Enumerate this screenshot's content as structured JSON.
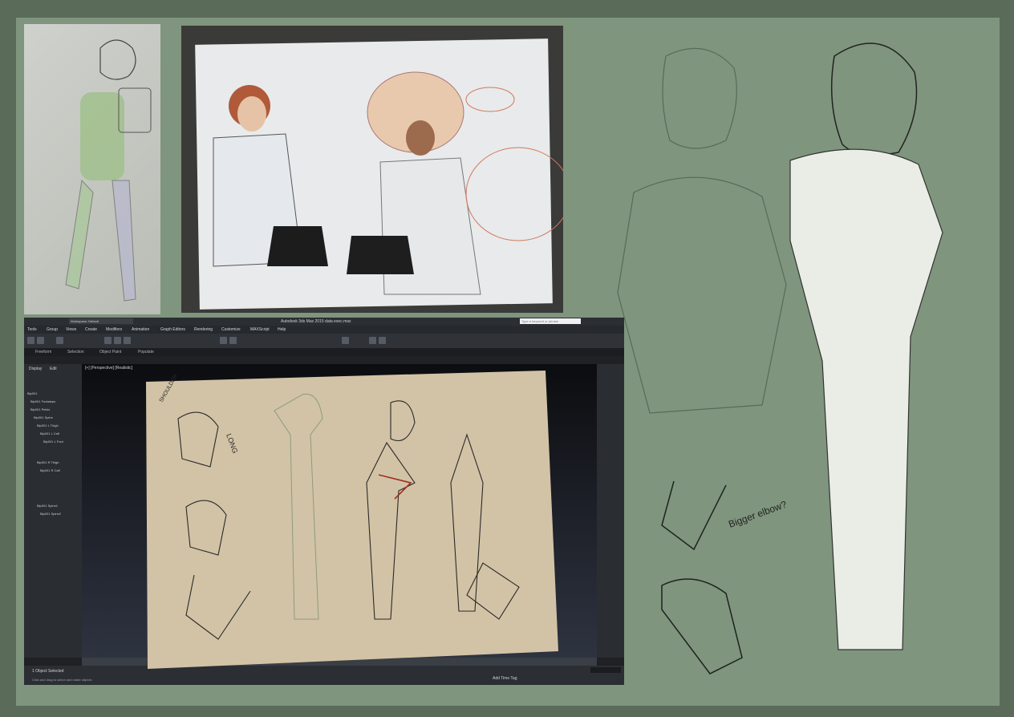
{
  "max": {
    "title": "Autodesk 3ds Max 2015    data exec.max",
    "workspace": "Workspace: Default",
    "search_placeholder": "Type a keyword or phrase",
    "menu": [
      "Tools",
      "Group",
      "Views",
      "Create",
      "Modifiers",
      "Animation",
      "Graph Editors",
      "Rendering",
      "Customize",
      "MAXScript",
      "Help"
    ],
    "ribbon": [
      "Freeform",
      "Selection",
      "Object Paint",
      "Populate"
    ],
    "panel_tabs": [
      "Display",
      "Edit"
    ],
    "viewport_label": "[+] [Perspective] [Realistic]",
    "tree": [
      "Bip001",
      "Bip001 Footsteps",
      "Bip001 Pelvis",
      "Bip001 Spine",
      "Bip001 L Thigh",
      "Bip001 L Calf",
      "Bip001 L Foot",
      "Bip001 R Thigh",
      "Bip001 R Calf",
      "Bip001 Spine1",
      "Bip001 Spine2"
    ],
    "status_selected": "1 Object Selected",
    "status_hint": "Click and drag to select and rotate objects",
    "add_time_tag": "Add Time Tag"
  },
  "sketch_notes": {
    "shoulder": "SHOULDER",
    "long": "LONG",
    "bigger_elbow": "Bigger elbow?"
  }
}
